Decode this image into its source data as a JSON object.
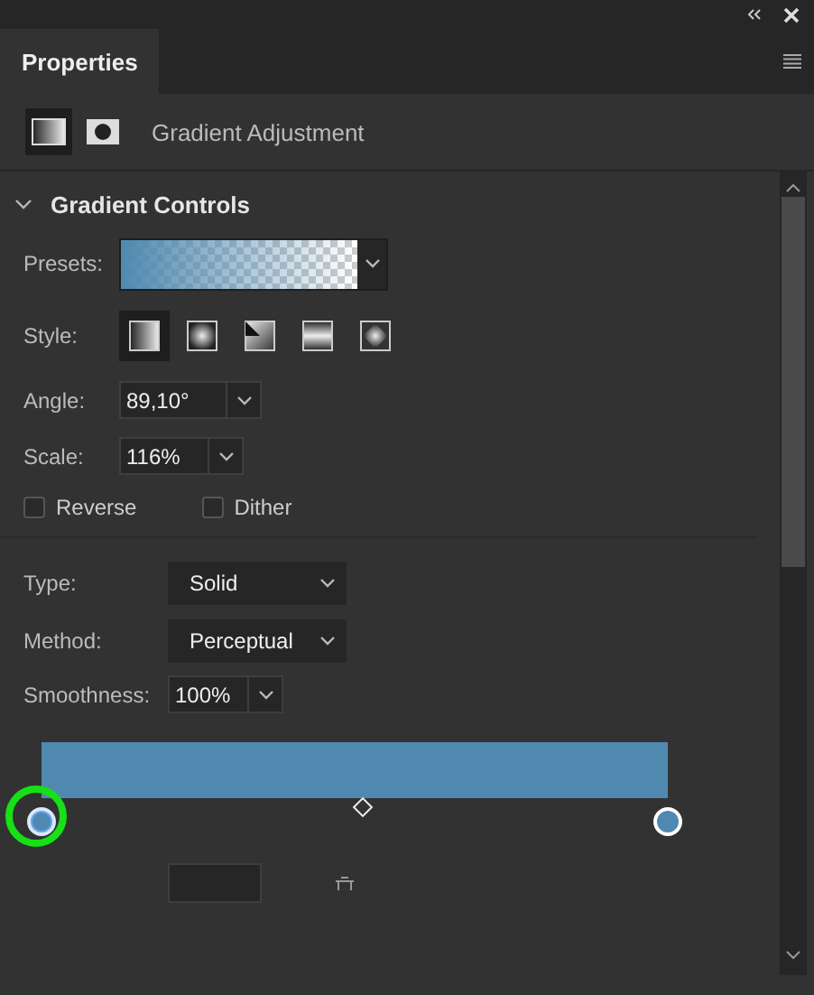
{
  "window": {
    "tab": "Properties"
  },
  "header": {
    "icons": [
      {
        "kind": "gradient",
        "selected": true
      },
      {
        "kind": "mask",
        "selected": false
      }
    ],
    "title": "Gradient Adjustment"
  },
  "section": {
    "title": "Gradient Controls",
    "expanded": true
  },
  "presets": {
    "label": "Presets:",
    "color": "#4f89b0"
  },
  "style": {
    "label": "Style:",
    "options": [
      {
        "kind": "linear",
        "selected": true
      },
      {
        "kind": "radial",
        "selected": false
      },
      {
        "kind": "angle",
        "selected": false
      },
      {
        "kind": "reflected",
        "selected": false
      },
      {
        "kind": "diamond",
        "selected": false
      }
    ]
  },
  "angle": {
    "label": "Angle:",
    "value": "89,10°"
  },
  "scale": {
    "label": "Scale:",
    "value": "116%"
  },
  "options": [
    {
      "label": "Reverse",
      "checked": false
    },
    {
      "label": "Dither",
      "checked": false
    }
  ],
  "type": {
    "label": "Type:",
    "value": "Solid"
  },
  "method": {
    "label": "Method:",
    "value": "Perceptual"
  },
  "smoothness": {
    "label": "Smoothness:",
    "value": "100%"
  },
  "gradient": {
    "color": "#4f89b0",
    "stops": [
      {
        "color": "#4f89b0",
        "selected": true,
        "highlighted": true
      },
      {
        "color": "#4f89b0",
        "selected": false,
        "highlighted": false
      }
    ]
  }
}
